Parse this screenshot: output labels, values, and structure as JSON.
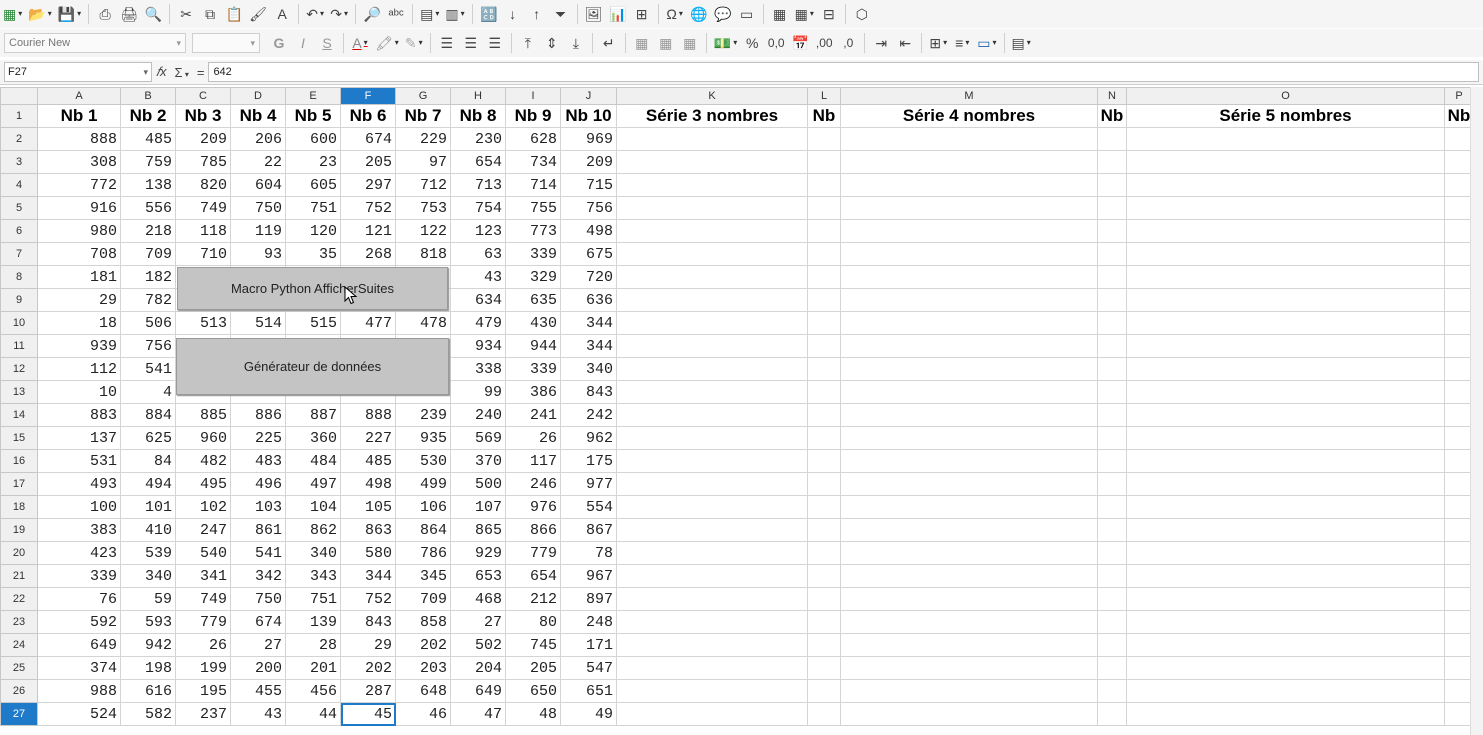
{
  "toolbar": {
    "font_name": "Courier New",
    "icons1": [
      "new-spreadsheet-icon",
      "open-folder-icon",
      "save-icon",
      "export-pdf-icon",
      "print-icon",
      "print-preview-icon",
      "cut-icon",
      "copy-icon",
      "paste-icon",
      "clone-formatting-icon",
      "clear-formatting-icon",
      "undo-icon",
      "redo-icon",
      "find-replace-icon",
      "spellcheck-icon",
      "row-icon",
      "column-icon",
      "sort-icon",
      "sort-ascending-icon",
      "sort-descending-icon",
      "autofilter-icon",
      "image-icon",
      "chart-icon",
      "pivot-table-icon",
      "special-character-icon",
      "hyperlink-icon",
      "comment-icon",
      "header-footer-icon",
      "define-print-area-icon",
      "freeze-rows-columns-icon",
      "split-window-icon",
      "show-draw-functions-icon"
    ],
    "glyphs1": [
      "▦",
      "📂",
      "💾",
      "⎙",
      "🖨",
      "🔍",
      "✂",
      "⧉",
      "📋",
      "🖌",
      "A",
      "↶",
      "↷",
      "🔎",
      "ᵃᵇᶜ",
      "▤",
      "▥",
      "🔠",
      "↓",
      "↑",
      "⏷",
      "🖼",
      "📊",
      "⊞",
      "Ω",
      "🌐",
      "💬",
      "▭",
      "▦",
      "▦",
      "⊟",
      "⬡"
    ],
    "bold_label": "G",
    "italic_label": "I",
    "underline_label": "S",
    "percent_label": "%",
    "number_format_label": "0,0",
    "decimal_add_label": ",00",
    "decimal_remove_label": ",0"
  },
  "formula_bar": {
    "cell_ref": "F27",
    "fx_label": "𝑓x",
    "sum_label": "Σ",
    "equals_label": "=",
    "value": "642"
  },
  "columns": [
    "A",
    "B",
    "C",
    "D",
    "E",
    "F",
    "G",
    "H",
    "I",
    "J",
    "K",
    "L",
    "M",
    "N",
    "O",
    "P"
  ],
  "selected_column": "F",
  "selected_row": "27",
  "headers": [
    "Nb 1",
    "Nb 2",
    "Nb 3",
    "Nb 4",
    "Nb 5",
    "Nb 6",
    "Nb 7",
    "Nb 8",
    "Nb 9",
    "Nb 10",
    "Série 3 nombres",
    "Nb",
    "Série 4 nombres",
    "Nb",
    "Série 5 nombres",
    "Nb"
  ],
  "rows": [
    [
      "2",
      [
        "888",
        "485",
        "209",
        "206",
        "600",
        "674",
        "229",
        "230",
        "628",
        "969"
      ]
    ],
    [
      "3",
      [
        "308",
        "759",
        "785",
        "22",
        "23",
        "205",
        "97",
        "654",
        "734",
        "209"
      ]
    ],
    [
      "4",
      [
        "772",
        "138",
        "820",
        "604",
        "605",
        "297",
        "712",
        "713",
        "714",
        "715"
      ]
    ],
    [
      "5",
      [
        "916",
        "556",
        "749",
        "750",
        "751",
        "752",
        "753",
        "754",
        "755",
        "756"
      ]
    ],
    [
      "6",
      [
        "980",
        "218",
        "118",
        "119",
        "120",
        "121",
        "122",
        "123",
        "773",
        "498"
      ]
    ],
    [
      "7",
      [
        "708",
        "709",
        "710",
        "93",
        "35",
        "268",
        "818",
        "63",
        "339",
        "675"
      ]
    ],
    [
      "8",
      [
        "181",
        "182",
        "",
        "",
        "",
        "",
        "",
        "43",
        "329",
        "720"
      ]
    ],
    [
      "9",
      [
        "29",
        "782",
        "",
        "",
        "",
        "",
        "",
        "634",
        "635",
        "636"
      ]
    ],
    [
      "10",
      [
        "18",
        "506",
        "513",
        "514",
        "515",
        "477",
        "478",
        "479",
        "430",
        "344"
      ]
    ],
    [
      "11",
      [
        "939",
        "756",
        "",
        "",
        "",
        "",
        "",
        "934",
        "944",
        "344"
      ]
    ],
    [
      "12",
      [
        "112",
        "541",
        "",
        "",
        "",
        "",
        "",
        "338",
        "339",
        "340"
      ]
    ],
    [
      "13",
      [
        "10",
        "4",
        "",
        "",
        "",
        "",
        "",
        "99",
        "386",
        "843"
      ]
    ],
    [
      "14",
      [
        "883",
        "884",
        "885",
        "886",
        "887",
        "888",
        "239",
        "240",
        "241",
        "242"
      ]
    ],
    [
      "15",
      [
        "137",
        "625",
        "960",
        "225",
        "360",
        "227",
        "935",
        "569",
        "26",
        "962"
      ]
    ],
    [
      "16",
      [
        "531",
        "84",
        "482",
        "483",
        "484",
        "485",
        "530",
        "370",
        "117",
        "175"
      ]
    ],
    [
      "17",
      [
        "493",
        "494",
        "495",
        "496",
        "497",
        "498",
        "499",
        "500",
        "246",
        "977"
      ]
    ],
    [
      "18",
      [
        "100",
        "101",
        "102",
        "103",
        "104",
        "105",
        "106",
        "107",
        "976",
        "554"
      ]
    ],
    [
      "19",
      [
        "383",
        "410",
        "247",
        "861",
        "862",
        "863",
        "864",
        "865",
        "866",
        "867"
      ]
    ],
    [
      "20",
      [
        "423",
        "539",
        "540",
        "541",
        "340",
        "580",
        "786",
        "929",
        "779",
        "78"
      ]
    ],
    [
      "21",
      [
        "339",
        "340",
        "341",
        "342",
        "343",
        "344",
        "345",
        "653",
        "654",
        "967"
      ]
    ],
    [
      "22",
      [
        "76",
        "59",
        "749",
        "750",
        "751",
        "752",
        "709",
        "468",
        "212",
        "897"
      ]
    ],
    [
      "23",
      [
        "592",
        "593",
        "779",
        "674",
        "139",
        "843",
        "858",
        "27",
        "80",
        "248"
      ]
    ],
    [
      "24",
      [
        "649",
        "942",
        "26",
        "27",
        "28",
        "29",
        "202",
        "502",
        "745",
        "171"
      ]
    ],
    [
      "25",
      [
        "374",
        "198",
        "199",
        "200",
        "201",
        "202",
        "203",
        "204",
        "205",
        "547"
      ]
    ],
    [
      "26",
      [
        "988",
        "616",
        "195",
        "455",
        "456",
        "287",
        "648",
        "649",
        "650",
        "651"
      ]
    ],
    [
      "27",
      [
        "524",
        "582",
        "237",
        "43",
        "44",
        "45",
        "46",
        "47",
        "48",
        "49"
      ]
    ]
  ],
  "buttons": {
    "macro": "Macro Python AfficherSuites",
    "generator": "Générateur de données"
  }
}
